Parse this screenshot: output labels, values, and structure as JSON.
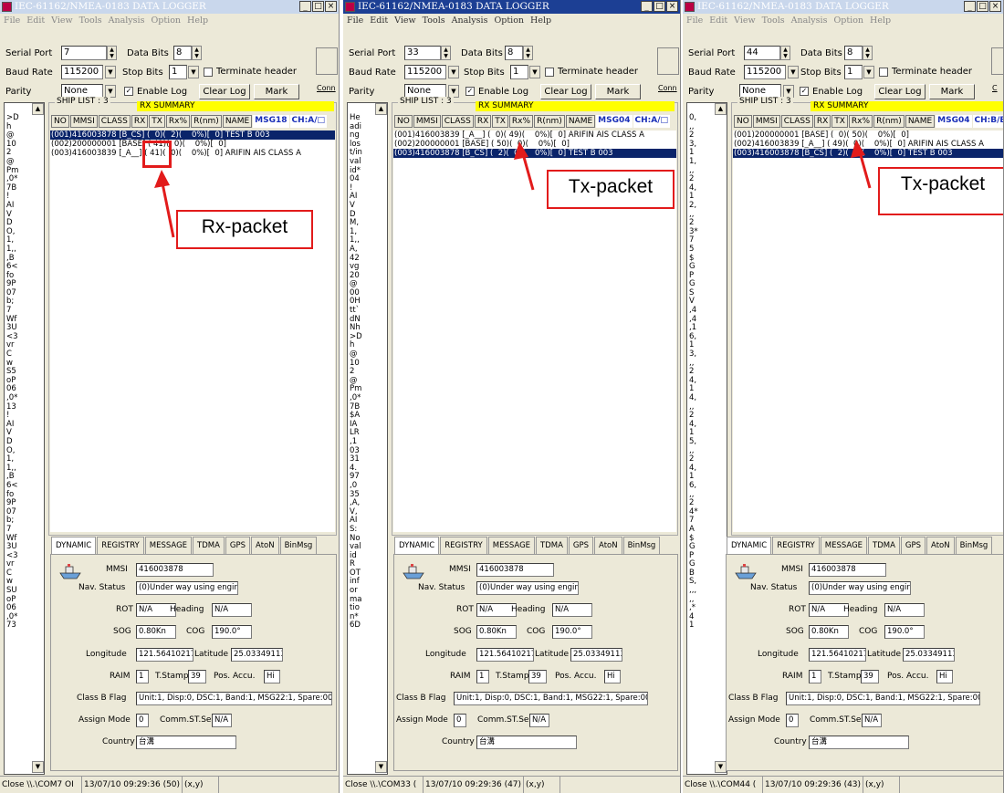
{
  "windows": [
    {
      "title": "IEC-61162/NMEA-0183 DATA LOGGER",
      "menu": [
        "File",
        "Edit",
        "View",
        "Tools",
        "Analysis",
        "Option",
        "Help"
      ],
      "serial_port_label": "Serial Port",
      "serial_port": "7",
      "data_bits_label": "Data Bits",
      "data_bits": "8",
      "baud_rate_label": "Baud Rate",
      "baud_rate": "115200",
      "stop_bits_label": "Stop Bits",
      "stop_bits": "1",
      "terminate_header_label": "Terminate header",
      "parity_label": "Parity",
      "parity": "None",
      "enable_log_label": "Enable Log",
      "clear_log_label": "Clear Log",
      "mark_label": "Mark",
      "conn_label": "Conn",
      "left_log": ">D\nh\n@\n10\n2\n@\nPm\n,0*\n7B\n!\nAI\nV\nD\nO,\n1,\n1,,\n,B\n6<\nfo\n9P\n07\nb;\n7\nWf\n3U\n<3\nvr\nC\nw\nS5\noP\n06\n,0*\n13\n!\nAI\nV\nD\nO,\n1,\n1,,\n,B\n6<\nfo\n9P\n07\nb;\n7\nWf\n3U\n<3\nvr\nC\nw\nSU\noP\n06\n,0*\n73",
      "ship_list_label": "SHIP LIST : 3",
      "rx_summary_label": "RX SUMMARY",
      "columns": [
        "NO",
        "MMSI",
        "CLASS",
        "RX",
        "TX",
        "Rx%",
        "R(nm)",
        "NAME"
      ],
      "msg_tag": "MSG18",
      "ch_tag": "CH:A/□",
      "rows": [
        "(001)416003878 [B_CS] (  0)(  2)(    0%)[  0] TEST B 003",
        "(002)200000001 [BASE] ( 41)(  0)(    0%)[  0]",
        "(003)416003839 [_A__] ( 41)(  0)(    0%)[  0] ARIFIN AIS CLASS A"
      ],
      "selected_row": 0,
      "status": [
        "Close \\\\.\\COM7 OI",
        "13/07/10 09:29:36 (50)",
        "(x,y)"
      ],
      "annotation": "Rx-packet"
    },
    {
      "title": "IEC-61162/NMEA-0183 DATA LOGGER",
      "menu": [
        "File",
        "Edit",
        "View",
        "Tools",
        "Analysis",
        "Option",
        "Help"
      ],
      "serial_port_label": "Serial Port",
      "serial_port": "33",
      "data_bits_label": "Data Bits",
      "data_bits": "8",
      "baud_rate_label": "Baud Rate",
      "baud_rate": "115200",
      "stop_bits_label": "Stop Bits",
      "stop_bits": "1",
      "terminate_header_label": "Terminate header",
      "parity_label": "Parity",
      "parity": "None",
      "enable_log_label": "Enable Log",
      "clear_log_label": "Clear Log",
      "mark_label": "Mark",
      "conn_label": "Conn",
      "left_log": "He\nadi\nng\nlos\nt/in\nval\nid*\n04\n!\nAI\nV\nD\nM,\n1,\n1,,\nA,\n42\nvg\n20\n@\n00\n0H\ntt`\ndN\nNh\n>D\nh\n@\n10\n2\n@\nPm\n,0*\n7B\n$A\nIA\nLR\n,1\n03\n31\n4.\n97\n,0\n35\n,A,\nV,\nAI\nS:\nNo\nval\nid\nR\nOT\ninf\nor\nma\ntio\nn*\n6D",
      "ship_list_label": "SHIP LIST : 3",
      "rx_summary_label": "RX SUMMARY",
      "columns": [
        "NO",
        "MMSI",
        "CLASS",
        "RX",
        "TX",
        "Rx%",
        "R(nm)",
        "NAME"
      ],
      "msg_tag": "MSG04",
      "ch_tag": "CH:A/□",
      "rows": [
        "(001)416003839 [_A__] (  0)( 49)(    0%)[  0] ARIFIN AIS CLASS A",
        "(002)200000001 [BASE] ( 50)(  0)(    0%)[  0]",
        "(003)416003878 [B_CS] (  2)(  0)(    0%)[  0] TEST B 003"
      ],
      "selected_row": 2,
      "status": [
        "Close \\\\.\\COM33 (",
        "13/07/10 09:29:36 (47)",
        "(x,y)"
      ],
      "annotation": "Tx-packet"
    },
    {
      "title": "IEC-61162/NMEA-0183 DATA LOGGER",
      "menu": [
        "File",
        "Edit",
        "View",
        "Tools",
        "Analysis",
        "Option",
        "Help"
      ],
      "serial_port_label": "Serial Port",
      "serial_port": "44",
      "data_bits_label": "Data Bits",
      "data_bits": "8",
      "baud_rate_label": "Baud Rate",
      "baud_rate": "115200",
      "stop_bits_label": "Stop Bits",
      "stop_bits": "1",
      "terminate_header_label": "Terminate header",
      "parity_label": "Parity",
      "parity": "None",
      "enable_log_label": "Enable Log",
      "clear_log_label": "Clear Log",
      "mark_label": "Mark",
      "conn_label": "C",
      "left_log": "0,\n,,\n2\n3,\n1\n1,\n,,\n2\n4,\n1\n2,\n,,\n2\n3*\n7\n5\n$\nG\nP\nG\nS\nV\n,4\n,4\n,1\n6,\n1\n3,\n,,\n2\n4,\n1\n4,\n,,\n2\n4,\n1\n5,\n,,\n2\n4,\n1\n6,\n,,\n2\n4*\n7\nA\n$\nG\nP\nG\nB\nS,\n,,,\n,,\n,*\n4\n1",
      "ship_list_label": "SHIP LIST : 3",
      "rx_summary_label": "RX SUMMARY",
      "columns": [
        "NO",
        "MMSI",
        "CLASS",
        "RX",
        "TX",
        "Rx%",
        "R(nm)",
        "NAME"
      ],
      "msg_tag": "MSG04",
      "ch_tag": "CH:B/B",
      "rows": [
        "(001)200000001 [BASE] (  0)( 50)(    0%)[  0]",
        "(002)416003839 [_A__] ( 49)(  0)(    0%)[  0] ARIFIN AIS CLASS A",
        "(003)416003878 [B_CS] (  2)(  0)(    0%)[  0] TEST B 003"
      ],
      "selected_row": 2,
      "status": [
        "Close \\\\.\\COM44 (",
        "13/07/10 09:29:36 (43)",
        "(x,y)"
      ],
      "annotation": "Tx-packet"
    }
  ],
  "tabs": [
    "DYNAMIC",
    "REGISTRY",
    "MESSAGE",
    "TDMA",
    "GPS",
    "AtoN",
    "BinMsg"
  ],
  "dynamic": {
    "mmsi_label": "MMSI",
    "mmsi": "416003878",
    "nav_status_label": "Nav. Status",
    "nav_status": "(0)Under way using engir",
    "rot_label": "ROT",
    "rot": "N/A",
    "heading_label": "Heading",
    "heading": "N/A",
    "sog_label": "SOG",
    "sog": "0.80Kn",
    "cog_label": "COG",
    "cog": "190.0°",
    "longitude_label": "Longitude",
    "longitude": "121.56410217",
    "latitude_label": "Latitude",
    "latitude": "25.03349113",
    "raim_label": "RAIM",
    "raim": "1",
    "tstamp_label": "T.Stamp",
    "tstamp": "39",
    "pos_accu_label": "Pos. Accu.",
    "pos_accu": "Hi",
    "class_b_flag_label": "Class B Flag",
    "class_b_flag_w1": "Unit:1, Disp:0, DSC:1, Band:1, MSG22:1, Spare:00",
    "class_b_flag_w2": "Unit:1, Disp:0, DSC:1, Band:1, MSG22:1, Spare:00",
    "class_b_flag_w3": "Unit:1, Disp:0, DSC:1, Band:1, MSG22:1, Spare:00",
    "assign_mode_label": "Assign Mode",
    "assign_mode": "0",
    "comm_st_sel_label": "Comm.ST.Sel",
    "comm_st_sel": "N/A",
    "country_label": "Country",
    "country": "台溝"
  }
}
